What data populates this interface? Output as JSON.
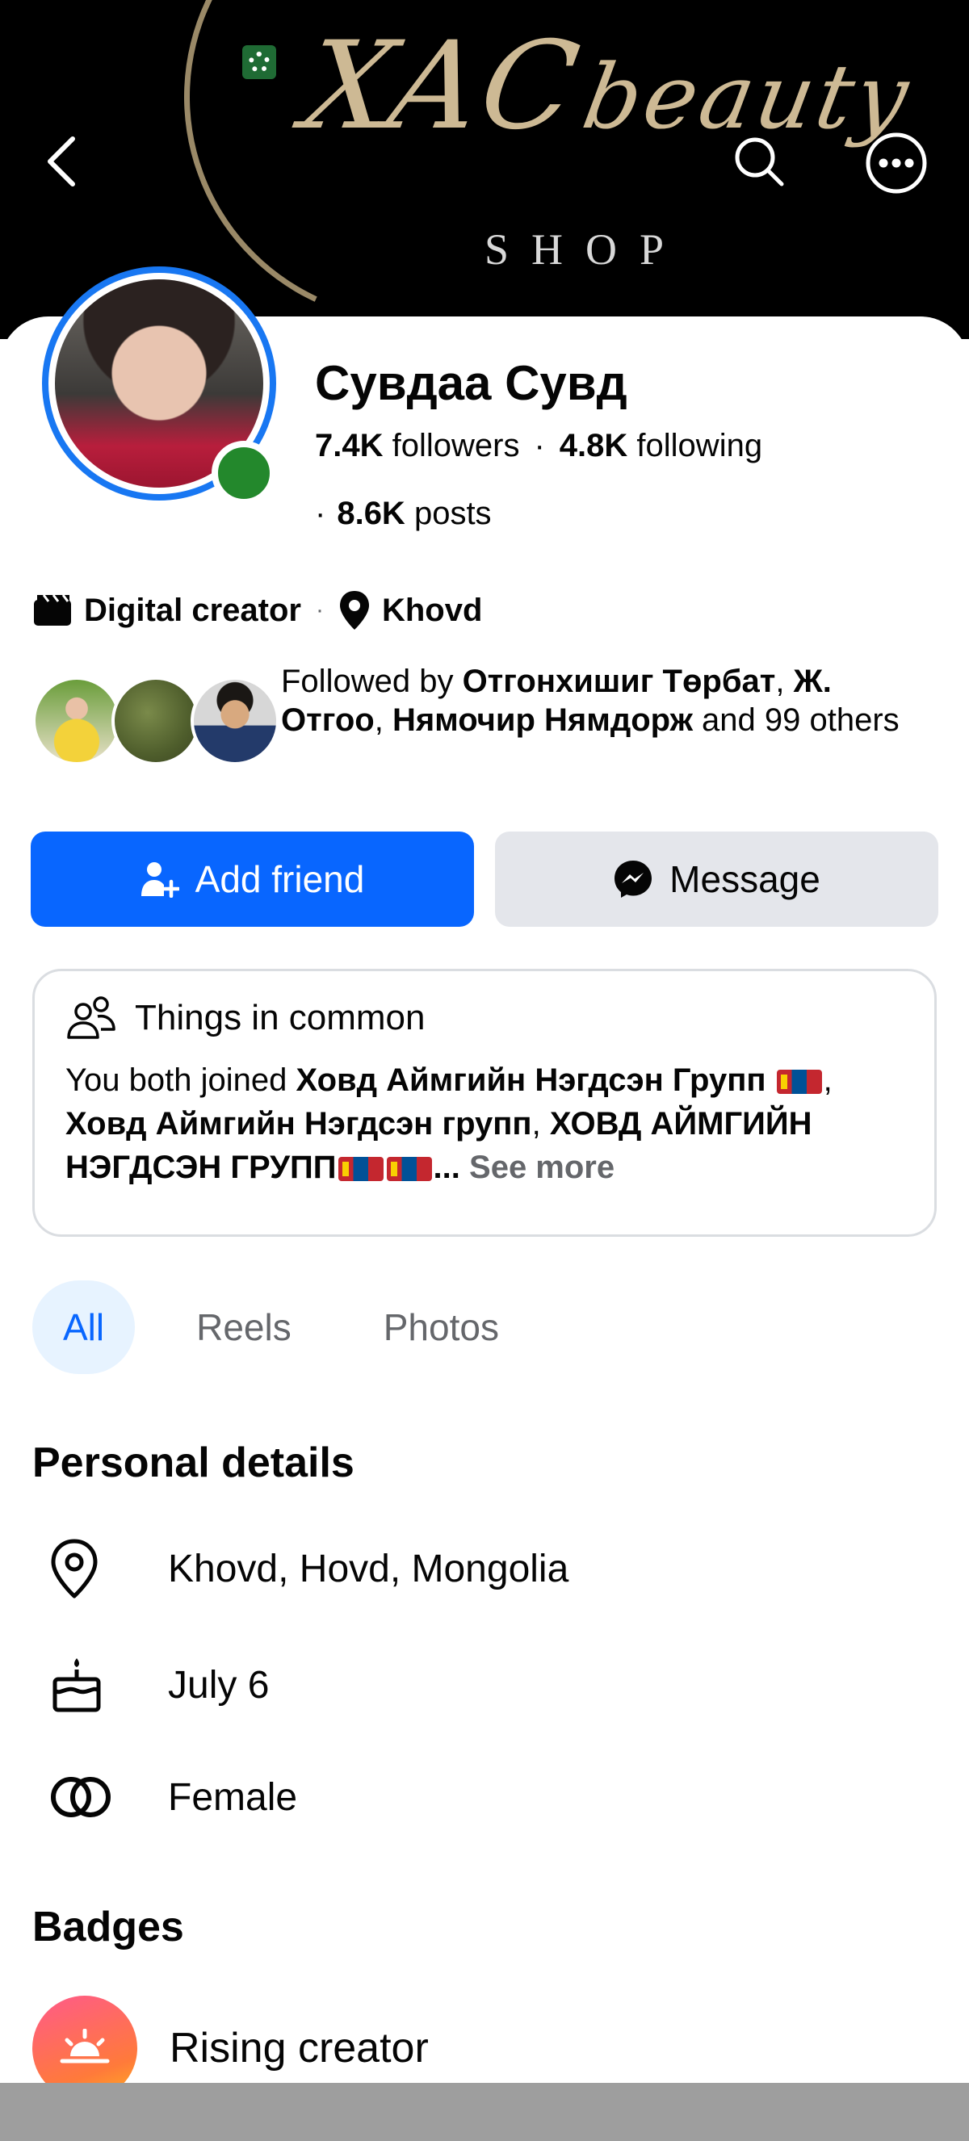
{
  "cover": {
    "script_text": "XAC",
    "script_text_2": "beauty",
    "shop_text": "SHOP"
  },
  "profile": {
    "name": "Сувдаа Сувд",
    "followers_count": "7.4K",
    "followers_label": "followers",
    "following_count": "4.8K",
    "following_label": "following",
    "posts_count": "8.6K",
    "posts_label": "posts",
    "category": "Digital creator",
    "location": "Khovd"
  },
  "mutuals": {
    "prefix": "Followed by ",
    "name1": "Отгонхишиг Төрбат",
    "name2": "Ж. Отгоо",
    "name3": "Нямочир Нямдорж",
    "suffix": " and 99 others"
  },
  "actions": {
    "add_friend": "Add friend",
    "message": "Message"
  },
  "common": {
    "title": "Things in common",
    "prefix": "You both joined ",
    "group1": "Ховд Аймгийн Нэгдсэн Групп",
    "group2": "Ховд Аймгийн Нэгдсэн групп",
    "group3": "ХОВД АЙМГИЙН НЭГДСЭН ГРУПП",
    "ellipsis": "...",
    "see_more": "See more"
  },
  "tabs": [
    {
      "label": "All",
      "active": true
    },
    {
      "label": "Reels",
      "active": false
    },
    {
      "label": "Photos",
      "active": false
    }
  ],
  "personal_details": {
    "title": "Personal details",
    "items": [
      {
        "icon": "location-pin-icon",
        "text": "Khovd, Hovd, Mongolia"
      },
      {
        "icon": "birthday-cake-icon",
        "text": "July 6"
      },
      {
        "icon": "gender-rings-icon",
        "text": "Female"
      }
    ]
  },
  "badges": {
    "title": "Badges",
    "items": [
      {
        "icon": "sunrise-icon",
        "text": "Rising creator"
      }
    ]
  },
  "colors": {
    "primary": "#0866ff",
    "online": "#23882c",
    "ring": "#1877f2",
    "secondary_btn": "#e4e6eb",
    "muted_text": "#65676b"
  }
}
